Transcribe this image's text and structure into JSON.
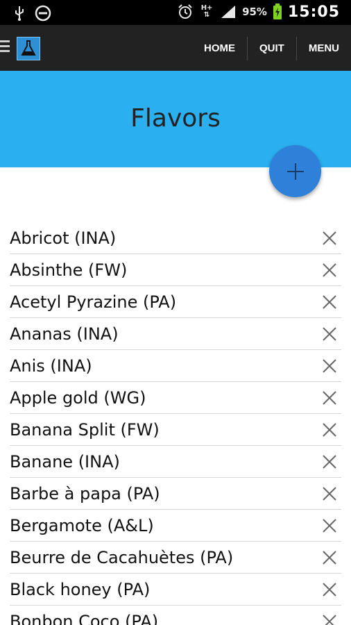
{
  "status_bar": {
    "battery": "95%",
    "time": "15:05",
    "network": "H+",
    "icons": [
      "usb-icon",
      "do-not-disturb-icon",
      "alarm-icon",
      "network-h-plus-icon",
      "signal-icon",
      "battery-charging-icon"
    ]
  },
  "app_bar": {
    "nav": {
      "home": "HOME",
      "quit": "QUIT",
      "menu": "MENU"
    },
    "icons": [
      "hamburger-icon",
      "flask-logo-icon"
    ]
  },
  "header": {
    "title": "Flavors",
    "background": "#2ab0f0"
  },
  "fab": {
    "icon": "plus-icon",
    "color": "#2f80d8"
  },
  "flavors": [
    "Abricot (INA)",
    "Absinthe (FW)",
    "Acetyl Pyrazine (PA)",
    "Ananas (INA)",
    "Anis (INA)",
    "Apple gold (WG)",
    "Banana Split (FW)",
    "Banane (INA)",
    "Barbe à papa (PA)",
    "Bergamote (A&L)",
    "Beurre de Cacahuètes (PA)",
    "Black honey (PA)",
    "Bonbon Coco (PA)"
  ],
  "row_delete_icon": "close-icon"
}
